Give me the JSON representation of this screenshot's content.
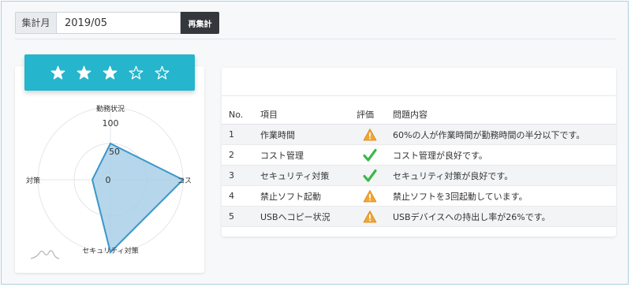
{
  "toolbar": {
    "period_label": "集計月",
    "period_value": "2019/05",
    "recalc_label": "再集計"
  },
  "rating": {
    "value": 3,
    "max": 5
  },
  "radar": {
    "axis_labels": [
      "勤務状況",
      "コス",
      "セキュリティ対策",
      "対策"
    ],
    "scale_labels": [
      "100",
      "50",
      "0"
    ],
    "scale_max": 100,
    "values": [
      50,
      100,
      100,
      25
    ]
  },
  "colors": {
    "accent": "#25b5cc",
    "radar_stroke": "#3a97cb",
    "radar_fill": "#a9cfe8",
    "warning": "#f2a531",
    "check": "#3cb84a",
    "button_dark": "#34383d"
  },
  "table": {
    "headers": [
      "No.",
      "項目",
      "評価",
      "問題内容"
    ],
    "rows": [
      {
        "no": "1",
        "item": "作業時間",
        "eval": "warning-icon",
        "issue": "60%の人が作業時間が勤務時間の半分以下です。"
      },
      {
        "no": "2",
        "item": "コスト管理",
        "eval": "check-icon",
        "issue": "コスト管理が良好です。"
      },
      {
        "no": "3",
        "item": "セキュリティ対策",
        "eval": "check-icon",
        "issue": "セキュリティ対策が良好です。"
      },
      {
        "no": "4",
        "item": "禁止ソフト起動",
        "eval": "warning-icon",
        "issue": "禁止ソフトを3回起動しています。"
      },
      {
        "no": "5",
        "item": "USBへコピー状況",
        "eval": "warning-icon",
        "issue": "USBデバイスへの持出し率が26%です。"
      }
    ]
  }
}
